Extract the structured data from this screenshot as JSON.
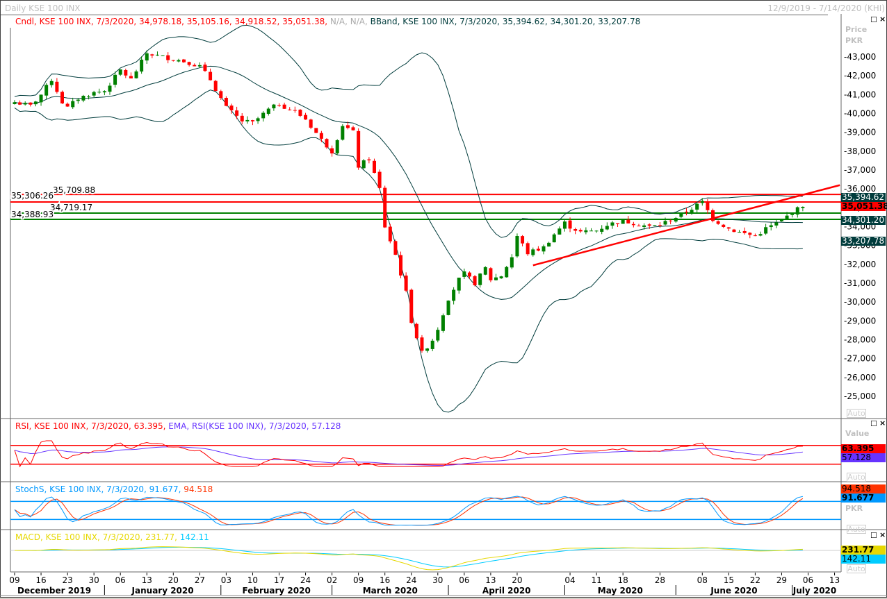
{
  "window": {
    "title": "Daily KSE 100 INX",
    "range": "12/9/2019 - 7/14/2020 (KHI)"
  },
  "legend": {
    "cndl": "Cndl, KSE 100 INX, 7/3/2020, 34,978.18, 35,105.16, 34,918.52, 35,051.38,",
    "na": "N/A, N/A,",
    "bband": "BBand, KSE 100 INX, 7/3/2020, 35,394.62, 34,301.20, 33,207.78",
    "rsi": "RSI, KSE 100 INX, 7/3/2020, 63.395,",
    "ema": "EMA, RSI(KSE 100 INX), 7/3/2020, 57.128",
    "stoch": "StochS, KSE 100 INX, 7/3/2020, 91.677,",
    "stoch2": "94.518",
    "macd": "MACD, KSE 100 INX, 7/3/2020, 231.77,",
    "macd2": "142.11"
  },
  "axis": {
    "price_title": "Price",
    "price_unit": "PKR",
    "value_title": "Value",
    "value_unit": "PKR",
    "auto": "Auto",
    "price_ticks": [
      "43,000",
      "42,000",
      "41,000",
      "40,000",
      "39,000",
      "38,000",
      "37,000",
      "36,000",
      "35,000",
      "34,000",
      "33,000",
      "32,000",
      "31,000",
      "30,000",
      "29,000",
      "28,000",
      "27,000",
      "26,000",
      "25,000"
    ],
    "day_ticks": [
      "09",
      "16",
      "23",
      "30",
      "06",
      "13",
      "20",
      "27",
      "03",
      "10",
      "17",
      "24",
      "02",
      "09",
      "16",
      "24",
      "30",
      "06",
      "13",
      "20",
      "04",
      "11",
      "18",
      "28",
      "08",
      "15",
      "22",
      "29",
      "06",
      "13"
    ],
    "months": [
      "December 2019",
      "January 2020",
      "February 2020",
      "March 2020",
      "April 2020",
      "May 2020",
      "June 2020",
      "July 2020"
    ]
  },
  "badges": {
    "bb_upper": "35,394.62",
    "close": "35,051.38",
    "bb_mid": "34,301.20",
    "bb_lower": "33,207.78",
    "rsi": "63.395",
    "ema": "57.128",
    "stoch_d": "94.518",
    "stoch_k": "91.677",
    "macd": "231.77",
    "signal": "142.11"
  },
  "levels": [
    {
      "value": 35709.88,
      "label": "35,709.88",
      "color": "#ff0000"
    },
    {
      "value": 35306.26,
      "label": "35,306.26",
      "color": "#ff0000"
    },
    {
      "value": 34719.17,
      "label": "34,719.17",
      "color": "#008000"
    },
    {
      "value": 34388.93,
      "label": "34,388.93",
      "color": "#008000"
    }
  ],
  "colors": {
    "up": "#008000",
    "down": "#ff0000",
    "band": "#003c3c",
    "rsi": "#ff0000",
    "ema": "#6633ff",
    "stoch_k": "#0099ff",
    "stoch_d": "#ff3300",
    "macd": "#e6d800",
    "signal": "#00ccff"
  },
  "chart_data": {
    "type": "candlestick",
    "title": "Daily KSE 100 INX",
    "ylabel": "Price PKR",
    "ylim": [
      24500,
      43500
    ],
    "trendline": [
      {
        "day": 98,
        "price": 31950
      },
      {
        "day": 156,
        "price": 36200
      }
    ],
    "close_keyframes": [
      [
        0,
        40600
      ],
      [
        3,
        40400
      ],
      [
        5,
        41000
      ],
      [
        7,
        41800
      ],
      [
        9,
        40600
      ],
      [
        10,
        40300
      ],
      [
        12,
        40800
      ],
      [
        15,
        41100
      ],
      [
        17,
        41200
      ],
      [
        20,
        42300
      ],
      [
        22,
        41800
      ],
      [
        25,
        43200
      ],
      [
        28,
        43000
      ],
      [
        30,
        42900
      ],
      [
        33,
        42700
      ],
      [
        35,
        42500
      ],
      [
        37,
        41800
      ],
      [
        40,
        40300
      ],
      [
        43,
        39600
      ],
      [
        45,
        39500
      ],
      [
        48,
        40200
      ],
      [
        50,
        40500
      ],
      [
        53,
        40100
      ],
      [
        55,
        39700
      ],
      [
        58,
        38600
      ],
      [
        60,
        38000
      ],
      [
        62,
        39400
      ],
      [
        64,
        39000
      ],
      [
        65,
        37200
      ],
      [
        67,
        37600
      ],
      [
        69,
        36000
      ],
      [
        70,
        34000
      ],
      [
        72,
        32500
      ],
      [
        74,
        30500
      ],
      [
        75,
        29000
      ],
      [
        77,
        27300
      ],
      [
        79,
        28000
      ],
      [
        80,
        28600
      ],
      [
        82,
        30200
      ],
      [
        84,
        31200
      ],
      [
        85,
        31500
      ],
      [
        87,
        31000
      ],
      [
        89,
        31800
      ],
      [
        90,
        31200
      ],
      [
        92,
        31400
      ],
      [
        94,
        32400
      ],
      [
        95,
        33500
      ],
      [
        97,
        32600
      ],
      [
        99,
        32800
      ],
      [
        100,
        32900
      ],
      [
        102,
        33600
      ],
      [
        104,
        34200
      ],
      [
        105,
        34000
      ],
      [
        107,
        33700
      ],
      [
        110,
        33800
      ],
      [
        112,
        34100
      ],
      [
        115,
        34300
      ],
      [
        117,
        34200
      ],
      [
        120,
        34000
      ],
      [
        122,
        34100
      ],
      [
        125,
        34500
      ],
      [
        127,
        34800
      ],
      [
        130,
        35300
      ],
      [
        132,
        34400
      ],
      [
        135,
        33900
      ],
      [
        137,
        33700
      ],
      [
        140,
        33500
      ],
      [
        142,
        33900
      ],
      [
        145,
        34300
      ],
      [
        147,
        34800
      ],
      [
        149,
        35051
      ]
    ]
  }
}
